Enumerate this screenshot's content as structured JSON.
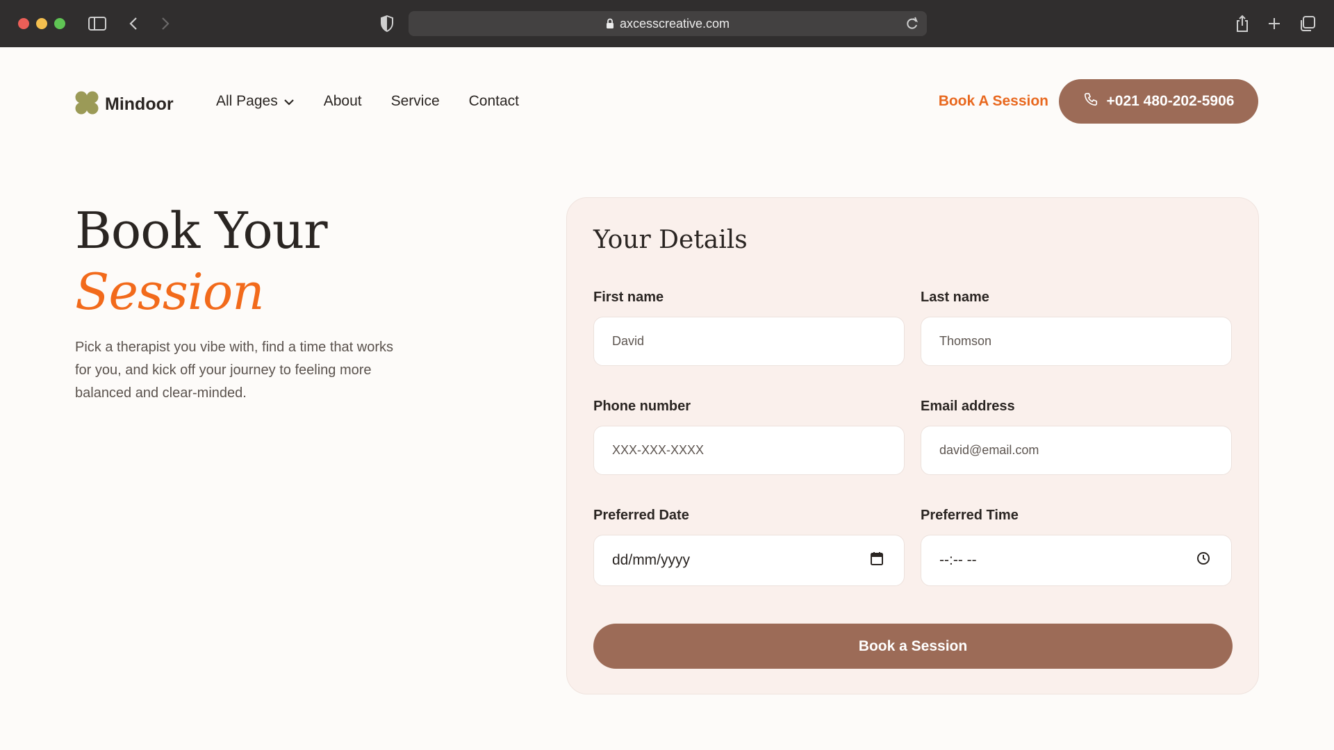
{
  "browser": {
    "url": "axcesscreative.com"
  },
  "header": {
    "logo_text": "Mindoor",
    "nav": [
      {
        "label": "All Pages"
      },
      {
        "label": "About"
      },
      {
        "label": "Service"
      },
      {
        "label": "Contact"
      }
    ],
    "book_link": "Book A Session",
    "phone": "+021 480-202-5906"
  },
  "hero": {
    "title_line1": "Book Your",
    "title_line2": "Session",
    "description": "Pick a therapist you vibe with, find a time that works for you, and kick off your journey to feeling more balanced and clear-minded."
  },
  "form": {
    "title": "Your Details",
    "first_name": {
      "label": "First name",
      "value": "David"
    },
    "last_name": {
      "label": "Last name",
      "value": "Thomson"
    },
    "phone": {
      "label": "Phone number",
      "value": "XXX-XXX-XXXX"
    },
    "email": {
      "label": "Email address",
      "value": "david@email.com"
    },
    "date": {
      "label": "Preferred Date",
      "value": "dd/mm/yyyy"
    },
    "time": {
      "label": "Preferred Time",
      "value": "--:-- --"
    },
    "submit": "Book a Session"
  },
  "colors": {
    "accent_orange": "#f26a1b",
    "brand_brown": "#9c6b57",
    "card_bg": "#faf0ec",
    "logo_green": "#9b9a57"
  }
}
